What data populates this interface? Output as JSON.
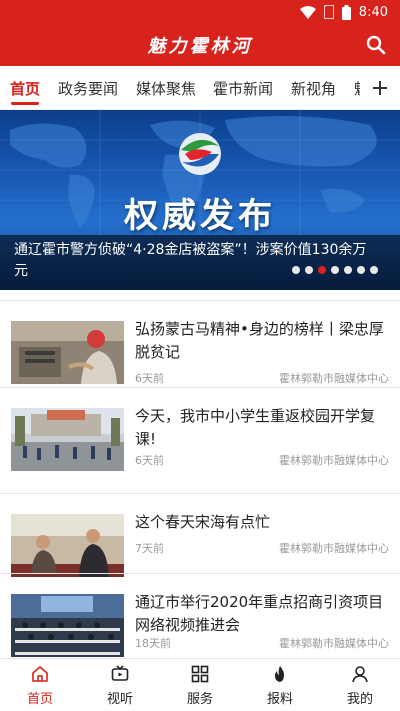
{
  "status_bar": {
    "time": "8:40",
    "icons": [
      "wifi-icon",
      "sim-icon",
      "battery-icon"
    ]
  },
  "app": {
    "title": "魅力霍林河",
    "search_icon": "search-icon",
    "brand_color": "#d8221c"
  },
  "tabs": {
    "items": [
      {
        "label": "首页",
        "active": true
      },
      {
        "label": "政务要闻"
      },
      {
        "label": "媒体聚焦"
      },
      {
        "label": "霍市新闻"
      },
      {
        "label": "新视角"
      },
      {
        "label": "魅"
      }
    ],
    "add_icon": "plus-icon"
  },
  "banner": {
    "headline": "权威发布",
    "caption": "通辽霍市警方侦破“4·28金店被盗案”！涉案价值130余万元",
    "dot_count": 7,
    "active_dot": 3
  },
  "news": [
    {
      "title": "弘扬蒙古马精神•身边的榜样丨梁忠厚脱贫记",
      "time": "6天前",
      "source": "霍林郭勒市融媒体中心"
    },
    {
      "title": "今天，我市中小学生重返校园开学复课!",
      "time": "6天前",
      "source": "霍林郭勒市融媒体中心"
    },
    {
      "title": "这个春天宋海有点忙",
      "time": "7天前",
      "source": "霍林郭勒市融媒体中心"
    },
    {
      "title": "通辽市举行2020年重点招商引资项目网络视频推进会",
      "time": "18天前",
      "source": "霍林郭勒市融媒体中心"
    }
  ],
  "bottom_nav": [
    {
      "label": "首页",
      "icon": "home-icon",
      "active": true
    },
    {
      "label": "视听",
      "icon": "tv-icon"
    },
    {
      "label": "服务",
      "icon": "grid-icon"
    },
    {
      "label": "报料",
      "icon": "fire-icon"
    },
    {
      "label": "我的",
      "icon": "user-icon"
    }
  ]
}
